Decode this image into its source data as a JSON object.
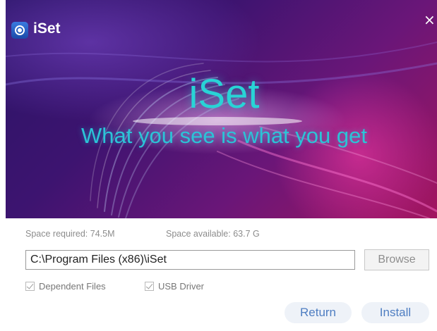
{
  "window": {
    "title": "iSet",
    "close_icon": "×"
  },
  "banner": {
    "brand": "iSet",
    "tagline": "What you see is what you get"
  },
  "space": {
    "required_label": "Space required:",
    "required_value": "74.5M",
    "available_label": "Space available:",
    "available_value": "63.7 G"
  },
  "install_path": {
    "value": "C:\\Program Files (x86)\\iSet"
  },
  "buttons": {
    "browse": "Browse",
    "return": "Return",
    "install": "Install"
  },
  "options": [
    {
      "label": "Dependent Files",
      "checked": true,
      "enabled": false
    },
    {
      "label": "USB Driver",
      "checked": true,
      "enabled": false
    }
  ],
  "colors": {
    "accent": "#4f7ec2",
    "brand_cyan": "#28d4d6",
    "banner_dark": "#2a1466",
    "banner_pink": "#a3155f"
  }
}
